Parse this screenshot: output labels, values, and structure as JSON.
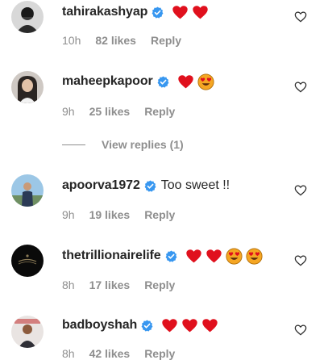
{
  "comments": [
    {
      "username": "tahirakashyap",
      "text": "",
      "emojis": [
        "red-heart",
        "red-heart"
      ],
      "time": "10h",
      "likes": "82 likes",
      "reply": "Reply"
    },
    {
      "username": "maheepkapoor",
      "text": "",
      "emojis": [
        "red-heart",
        "heart-eyes"
      ],
      "time": "9h",
      "likes": "25 likes",
      "reply": "Reply"
    },
    {
      "username": "apoorva1972",
      "text": "Too sweet !!",
      "emojis": [],
      "time": "9h",
      "likes": "19 likes",
      "reply": "Reply"
    },
    {
      "username": "thetrillionairelife",
      "text": "",
      "emojis": [
        "red-heart",
        "red-heart",
        "heart-eyes",
        "heart-eyes"
      ],
      "time": "8h",
      "likes": "17 likes",
      "reply": "Reply"
    },
    {
      "username": "badboyshah",
      "text": "",
      "emojis": [
        "red-heart",
        "red-heart",
        "red-heart"
      ],
      "time": "8h",
      "likes": "42 likes",
      "reply": "Reply"
    }
  ],
  "view_replies": "View replies (1)",
  "colors": {
    "username": "#262626",
    "meta": "#8e8e8e",
    "verified": "#3897f0",
    "heart": "#e0101d",
    "emoji_face": "#f5a623"
  }
}
